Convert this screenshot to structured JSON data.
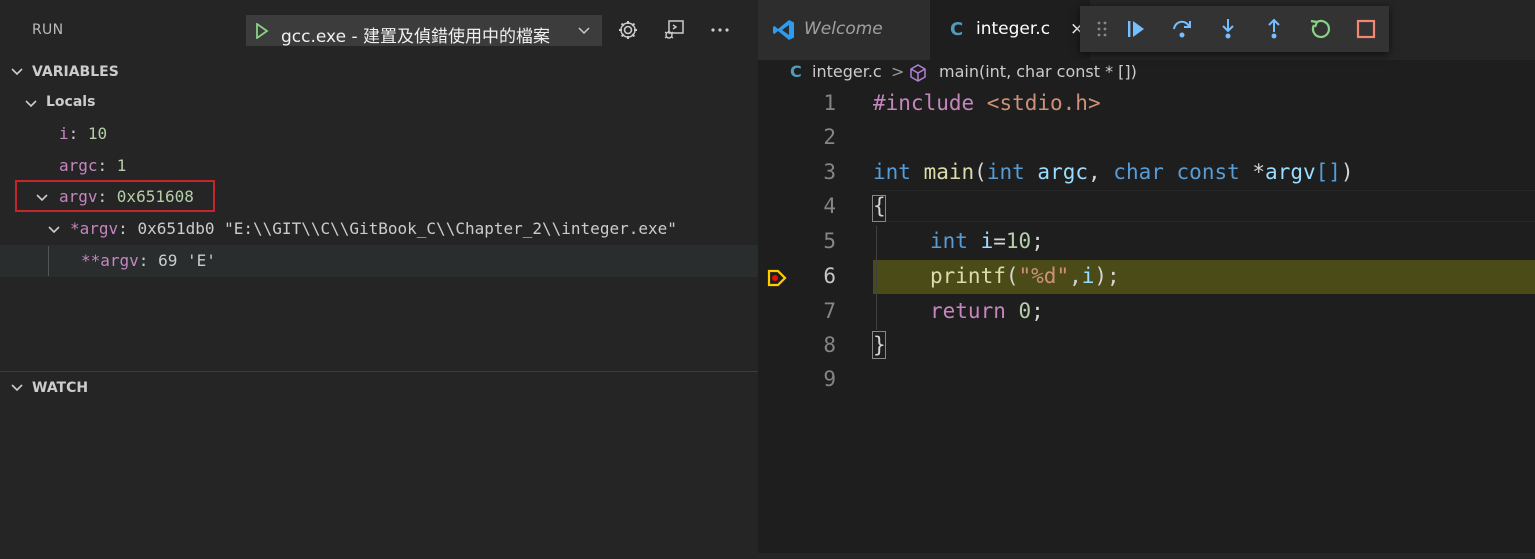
{
  "sidebar": {
    "title": "RUN",
    "config_label": "gcc.exe - 建置及偵錯使用中的檔案",
    "variables": {
      "title": "VARIABLES",
      "locals_label": "Locals",
      "rows": [
        {
          "name": "i",
          "sep": ": ",
          "value": "10"
        },
        {
          "name": "argc",
          "sep": ": ",
          "value": "1"
        },
        {
          "name": "argv",
          "sep": ": ",
          "value": "0x651608"
        },
        {
          "name": "*argv",
          "sep": ": ",
          "value": "0x651db0 \"E:\\\\GIT\\\\C\\\\GitBook_C\\\\Chapter_2\\\\integer.exe\""
        },
        {
          "name": "**argv",
          "sep": ": ",
          "value": "69 'E'"
        }
      ]
    },
    "watch": {
      "title": "WATCH"
    }
  },
  "editor": {
    "tabs": [
      {
        "label": "Welcome"
      },
      {
        "label": "integer.c",
        "icon_text": "C",
        "close": "×"
      }
    ],
    "breadcrumb": {
      "file": "integer.c",
      "sep": ">",
      "symbol": "main(int, char const * [])"
    },
    "line_numbers": [
      "1",
      "2",
      "3",
      "4",
      "5",
      "6",
      "7",
      "8",
      "9"
    ],
    "code": {
      "l1_pre": "#include",
      "l1_inc": " <stdio.h>",
      "l3_int": "int",
      "l3_main": "main",
      "l3_paren": "(",
      "l3_int2": "int",
      "l3_argc": "argc",
      "l3_comma": ", ",
      "l3_char": "char",
      "l3_const": "const",
      "l3_star": " *",
      "l3_argv": "argv",
      "l3_brackets": "[]",
      "l3_close": ")",
      "l4": "{",
      "l5_int": "int",
      "l5_i": "i",
      "l5_eq": "=",
      "l5_num": "10",
      "l5_semi": ";",
      "l6_fn": "printf",
      "l6_open": "(",
      "l6_str": "\"%d\"",
      "l6_comma": ",",
      "l6_i": "i",
      "l6_end": ");",
      "l7_ret": "return",
      "l7_num": "0",
      "l7_semi": ";",
      "l8": "}"
    },
    "current_line": 6
  },
  "icons": {
    "accent_blue": "#75beff",
    "accent_green": "#89d185",
    "accent_red": "#f48771",
    "breakpoint": "#ffcc00",
    "highlight_box": "#c5262c"
  }
}
